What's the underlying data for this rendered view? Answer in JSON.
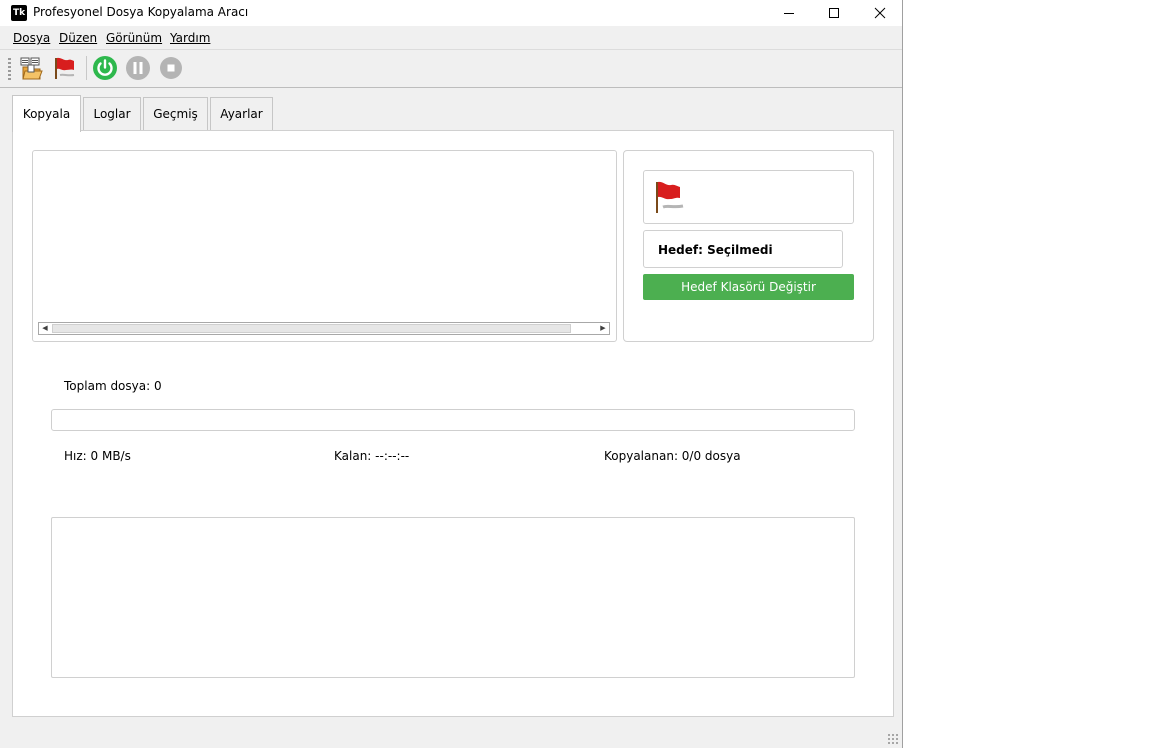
{
  "window": {
    "title": "Profesyonel Dosya Kopyalama Aracı",
    "icon_text": "Tk"
  },
  "menu": [
    {
      "label": "Dosya"
    },
    {
      "label": "Düzen"
    },
    {
      "label": "Görünüm"
    },
    {
      "label": "Yardım"
    }
  ],
  "toolbar": {
    "icons": [
      "file-list-icon",
      "flag-icon",
      "power-icon",
      "pause-icon",
      "stop-icon"
    ]
  },
  "tabs": [
    {
      "label": "Kopyala",
      "active": true
    },
    {
      "label": "Loglar",
      "active": false
    },
    {
      "label": "Geçmiş",
      "active": false
    },
    {
      "label": "Ayarlar",
      "active": false
    }
  ],
  "destination": {
    "label": "Hedef: Seçilmedi",
    "change_button": "Hedef Klasörü Değiştir"
  },
  "stats": {
    "total_files": "Toplam dosya: 0",
    "speed": "Hız: 0 MB/s",
    "remaining": "Kalan: --:--:--",
    "copied": "Kopyalanan: 0/0 dosya",
    "progress": 0
  },
  "colors": {
    "accent": "#4caf50",
    "flag_red": "#d81e1e",
    "power_green": "#2eb84d"
  }
}
